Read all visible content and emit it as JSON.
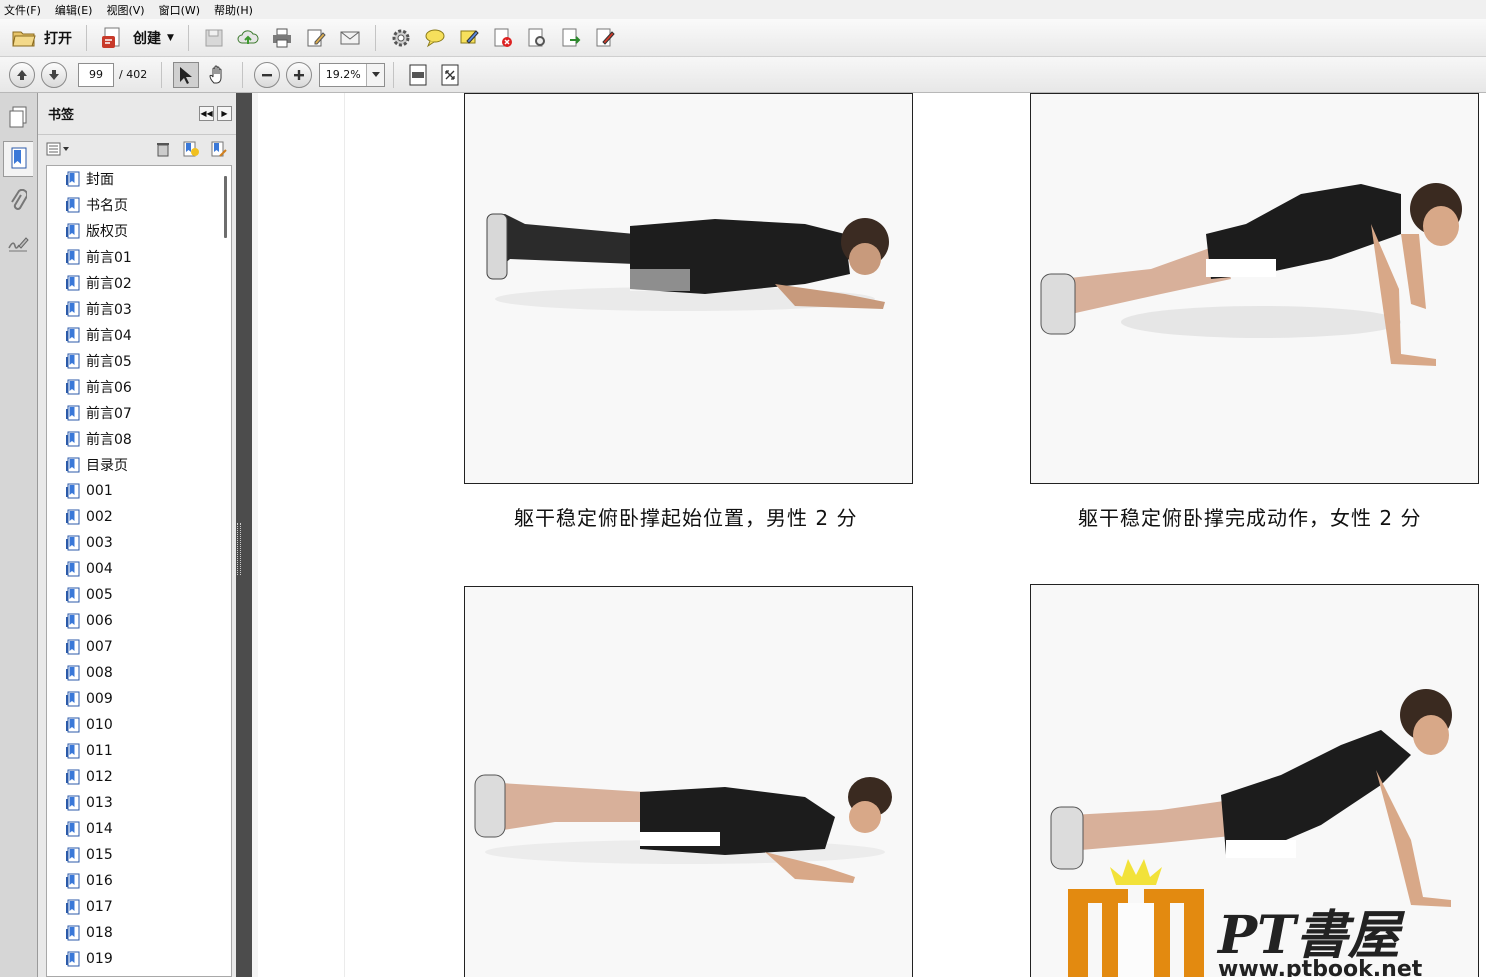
{
  "menu": [
    "文件(F)",
    "编辑(E)",
    "视图(V)",
    "窗口(W)",
    "帮助(H)"
  ],
  "toolbar": {
    "open_label": "打开",
    "create_label": "创建"
  },
  "nav": {
    "current_page": "99",
    "total_pages": "/ 402",
    "zoom": "19.2%"
  },
  "bookmarks": {
    "title": "书签",
    "items": [
      "封面",
      "书名页",
      "版权页",
      "前言01",
      "前言02",
      "前言03",
      "前言04",
      "前言05",
      "前言06",
      "前言07",
      "前言08",
      "目录页",
      "001",
      "002",
      "003",
      "004",
      "005",
      "006",
      "007",
      "008",
      "009",
      "010",
      "011",
      "012",
      "013",
      "014",
      "015",
      "016",
      "017",
      "018",
      "019"
    ]
  },
  "document": {
    "captions": [
      "躯干稳定俯卧撑起始位置，男性 2 分",
      "躯干稳定俯卧撑完成动作，女性 2 分"
    ]
  },
  "watermark": {
    "logo_text": "PT書屋",
    "url": "www.ptbook.net"
  }
}
